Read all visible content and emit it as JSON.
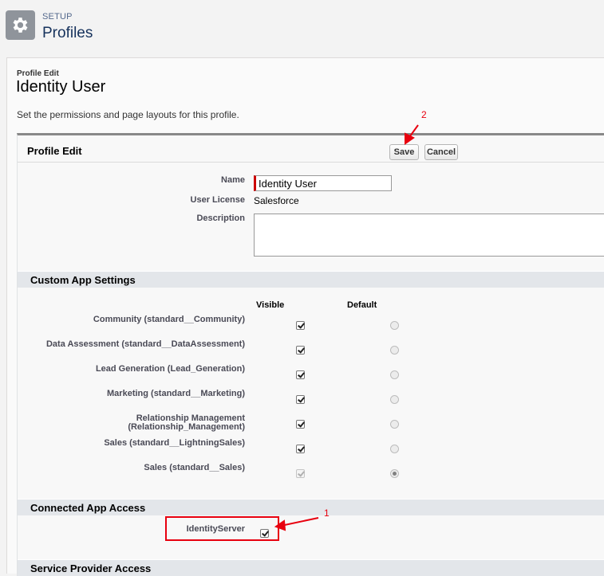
{
  "header": {
    "section": "SETUP",
    "title": "Profiles",
    "icon": "gear-icon"
  },
  "page": {
    "label": "Profile Edit",
    "title": "Identity User",
    "description": "Set the permissions and page layouts for this profile."
  },
  "block": {
    "title": "Profile Edit",
    "save_label": "Save",
    "cancel_label": "Cancel"
  },
  "fields": {
    "name_label": "Name",
    "name_value": "Identity User",
    "license_label": "User License",
    "license_value": "Salesforce",
    "description_label": "Description",
    "description_value": ""
  },
  "custom_app_settings": {
    "heading": "Custom App Settings",
    "col_visible": "Visible",
    "col_default": "Default",
    "apps": [
      {
        "label": "Community (standard__Community)",
        "visible": true,
        "default": false
      },
      {
        "label": "Data Assessment (standard__DataAssessment)",
        "visible": true,
        "default": false
      },
      {
        "label": "Lead Generation (Lead_Generation)",
        "visible": true,
        "default": false
      },
      {
        "label": "Marketing (standard__Marketing)",
        "visible": true,
        "default": false
      },
      {
        "label": "Relationship Management\n(Relationship_Management)",
        "visible": true,
        "default": false
      },
      {
        "label": "Sales (standard__LightningSales)",
        "visible": true,
        "default": false
      },
      {
        "label": "Sales (standard__Sales)",
        "visible": true,
        "default": true
      }
    ]
  },
  "connected_app_access": {
    "heading": "Connected App Access",
    "item_label": "IdentityServer",
    "checked": true
  },
  "service_provider_access": {
    "heading": "Service Provider Access"
  },
  "annotations": {
    "marker_1": "1",
    "marker_2": "2",
    "color": "#e8000f"
  },
  "colors": {
    "required_bar": "#cc0000",
    "section_bg": "#e3e6ea",
    "block_border": "#888888"
  }
}
